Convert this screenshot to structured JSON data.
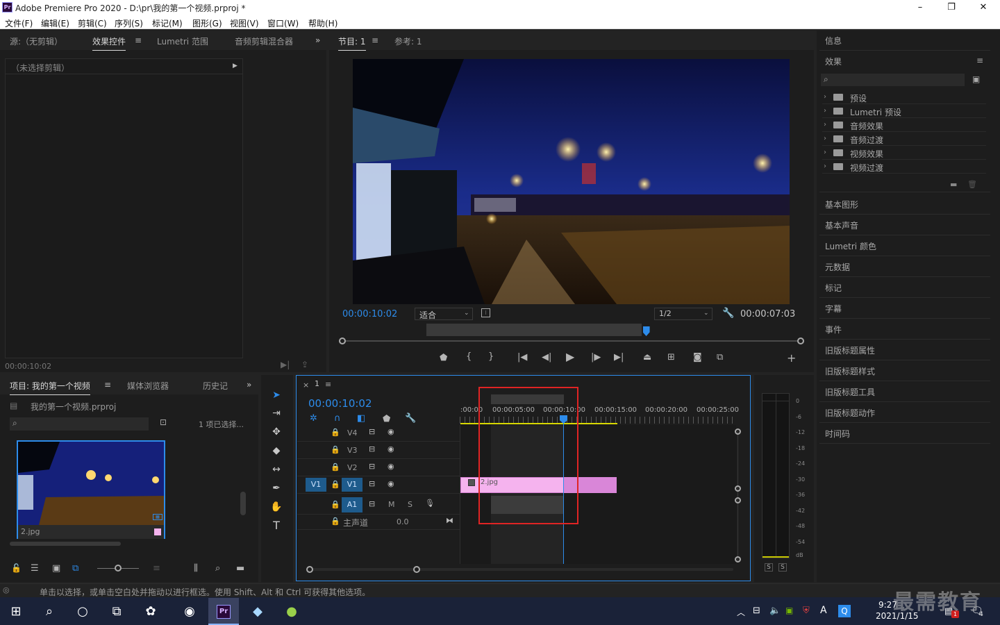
{
  "window": {
    "title": "Adobe Premiere Pro 2020 - D:\\pr\\我的第一个视频.prproj *",
    "app_icon": "Pr",
    "minimize": "–",
    "maximize": "❐",
    "close": "✕"
  },
  "menu": [
    "文件(F)",
    "编辑(E)",
    "剪辑(C)",
    "序列(S)",
    "标记(M)",
    "图形(G)",
    "视图(V)",
    "窗口(W)",
    "帮助(H)"
  ],
  "source_panel": {
    "tabs": [
      "源:（无剪辑）",
      "效果控件",
      "Lumetri 范围",
      "音频剪辑混合器"
    ],
    "empty_label": "（未选择剪辑）",
    "timecode": "00:00:10:02"
  },
  "program_monitor": {
    "tabs": [
      "节目: 1",
      "参考: 1"
    ],
    "current_time": "00:00:10:02",
    "fit": "适合",
    "resolution": "1/2",
    "duration": "00:00:07:03",
    "playhead_fraction": 0.663
  },
  "project_panel": {
    "tabs": [
      "项目: 我的第一个视频",
      "媒体浏览器",
      "历史记"
    ],
    "file": "我的第一个视频.prproj",
    "selection": "1 项已选择...",
    "thumbnail_label": "2.jpg"
  },
  "timeline": {
    "tab": "1",
    "timecode": "00:00:10:02",
    "ruler": [
      ":00:00",
      "00:00:05:00",
      "00:00:10:00",
      "00:00:15:00",
      "00:00:20:00",
      "00:00:25:00"
    ],
    "video_tracks": [
      "V4",
      "V3",
      "V2",
      "V1"
    ],
    "source_patch": "V1",
    "audio_track": "A1",
    "audio_buttons": [
      "M",
      "S"
    ],
    "master_label": "主声道",
    "master_value": "0.0",
    "clip_name": "2.jpg",
    "clip_color": "#f5b3ee"
  },
  "audio_meter": {
    "scale": [
      "0",
      "-6",
      "-12",
      "-18",
      "-24",
      "-30",
      "-36",
      "-42",
      "-48",
      "-54",
      "dB"
    ],
    "solo": [
      "S",
      "S"
    ]
  },
  "right_panel": {
    "info_label": "信息",
    "effects_label": "效果",
    "effects_tree": [
      "预设",
      "Lumetri 预设",
      "音频效果",
      "音频过渡",
      "视频效果",
      "视频过渡"
    ],
    "sections": [
      "基本图形",
      "基本声音",
      "Lumetri 颜色",
      "元数据",
      "标记",
      "字幕",
      "事件",
      "旧版标题属性",
      "旧版标题样式",
      "旧版标题工具",
      "旧版标题动作",
      "时间码"
    ]
  },
  "status_bar": {
    "text": "单击以选择，或单击空白处并拖动以进行框选。使用 Shift、Alt 和 Ctrl 可获得其他选项。"
  },
  "taskbar": {
    "time": "9:27",
    "date": "2021/1/15",
    "ime": "A",
    "notification_count": "4",
    "badge": "1",
    "watermark": "最需教育"
  },
  "colors": {
    "accent": "#2d8ceb",
    "highlight_box": "#e02424",
    "clip": "#f5b3ee",
    "work_area": "#d8d800"
  }
}
